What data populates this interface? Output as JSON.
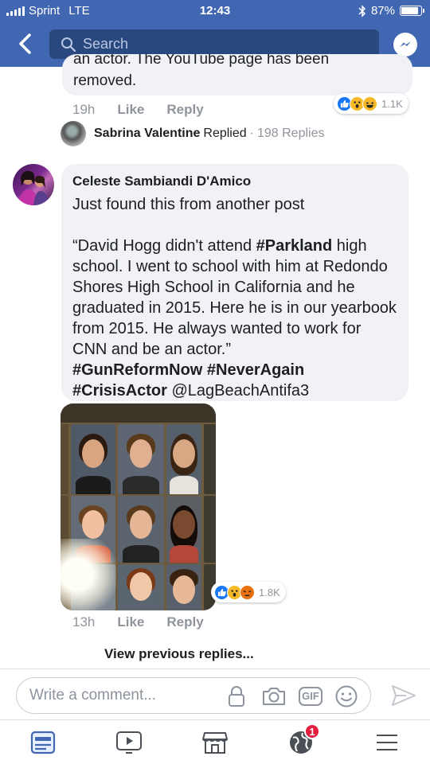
{
  "status_bar": {
    "carrier": "Sprint",
    "network": "LTE",
    "time": "12:43",
    "battery": "87%",
    "battery_level": 0.87
  },
  "header": {
    "search_placeholder": "Search"
  },
  "previous_comment": {
    "visible_text_line": "removed.",
    "partial_text_line": "an actor. The YouTube page has been",
    "time": "19h",
    "like_label": "Like",
    "reply_label": "Reply",
    "reactions": [
      "like",
      "wow",
      "haha"
    ],
    "reaction_count": "1.1K"
  },
  "reply_thread": {
    "name": "Sabrina Valentine",
    "action": "Replied",
    "separator": "·",
    "count": "198 Replies"
  },
  "comment": {
    "author": "Celeste Sambiandi D'Amico",
    "line1": "Just found this from another post",
    "quote_start": "“David Hogg didn't attend ",
    "hashtag_parkland": "#Parkland",
    "quote_rest": " high school. I went to school with him at Redondo Shores High School in California and he graduated in 2015. Here he is in our yearbook from 2015. He always wanted to work for CNN and be an actor.”",
    "hashtag_gunreform": "#GunReformNow",
    "hashtag_neveragain": "#NeverAgain",
    "hashtag_crisisactor": "#CrisisActor",
    "mention": "@LagBeachAntifa3",
    "time": "13h",
    "like_label": "Like",
    "reply_label": "Reply",
    "reactions": [
      "like",
      "wow",
      "angry"
    ],
    "reaction_count": "1.8K"
  },
  "view_previous_label": "View previous replies...",
  "composer": {
    "placeholder": "Write a comment...",
    "gif_label": "GIF"
  },
  "tabbar": {
    "notifications_badge": "1"
  },
  "colors": {
    "brand": "#4267b2",
    "brand_dark": "#29487d",
    "bubble": "#f0f2f5",
    "muted": "#90949c",
    "like_blue": "#1877f2",
    "wow_yellow": "#f7b928",
    "angry_orange": "#e9710f",
    "badge_red": "#e41e3f"
  }
}
